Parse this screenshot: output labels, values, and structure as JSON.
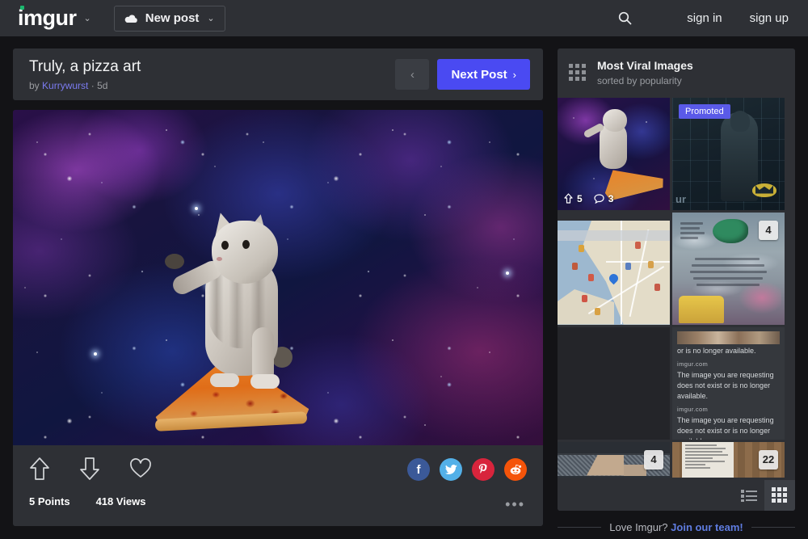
{
  "header": {
    "logo": "imgur",
    "logo_caret": "⌄",
    "new_post_label": "New post",
    "new_post_caret": "⌄",
    "search_icon": "search-icon",
    "sign_in": "sign in",
    "sign_up": "sign up"
  },
  "post": {
    "title": "Truly, a pizza art",
    "by_prefix": "by",
    "author": "Kurrywurst",
    "separator": "·",
    "age": "5d",
    "prev_label": "‹",
    "next_label": "Next Post",
    "next_chevron": "›",
    "image_alt": "kitten riding a pizza slice through outer space",
    "points": "5 Points",
    "views": "418 Views",
    "more_label": "•••",
    "share": [
      {
        "name": "facebook",
        "glyph": "f",
        "color": "#3b5998"
      },
      {
        "name": "twitter",
        "glyph": "ᵗ",
        "color": "#53b0e8"
      },
      {
        "name": "pinterest",
        "glyph": "P",
        "color": "#d8243c"
      },
      {
        "name": "reddit",
        "glyph": "ⓡ",
        "color": "#f5540a"
      }
    ]
  },
  "sidebar": {
    "title": "Most Viral Images",
    "subtitle": "sorted by popularity",
    "grid_icon": "grid-icon",
    "thumbnails": [
      {
        "name": "thumb-space-cat",
        "points": "5",
        "comments": "3",
        "badge": ""
      },
      {
        "name": "thumb-promoted-batman",
        "promoted": "Promoted",
        "corner_text": "ur",
        "badge": ""
      },
      {
        "name": "thumb-map",
        "badge": ""
      },
      {
        "name": "thumb-pokemon-card",
        "badge": "4"
      },
      {
        "name": "thumb-error-text",
        "badge": "",
        "domain": "imgur.com",
        "message": "The image you are requesting does not exist or is no longer available."
      },
      {
        "name": "thumb-construction",
        "badge": "4"
      },
      {
        "name": "thumb-receipt",
        "badge": "22"
      }
    ],
    "view_list_icon": "list-view-icon",
    "view_grid_icon": "grid-view-icon"
  },
  "footer": {
    "join_prefix": "Love Imgur?",
    "join_link": "Join our team!"
  },
  "colors": {
    "accent": "#4a4af2",
    "page_bg": "#131316",
    "panel_bg": "#2e3035",
    "nav_bg": "#2e3035",
    "link": "#7b7bf0",
    "logo_dot": "#1bb76e"
  }
}
